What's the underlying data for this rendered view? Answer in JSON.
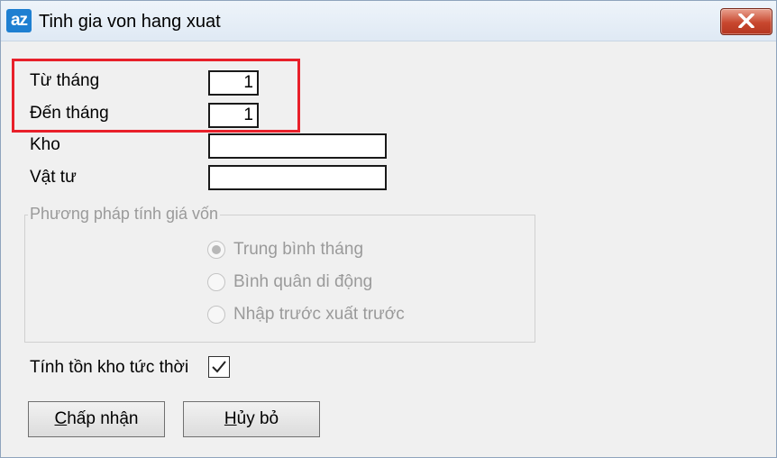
{
  "window": {
    "title": "Tinh gia von hang xuat",
    "icon_text": "az"
  },
  "form": {
    "from_month_label": "Từ tháng",
    "from_month_value": "1",
    "to_month_label": "Đến tháng",
    "to_month_value": "1",
    "warehouse_label": "Kho",
    "warehouse_value": "",
    "material_label": "Vật tư",
    "material_value": ""
  },
  "method_group": {
    "legend": "Phương pháp tính giá vốn",
    "options": [
      {
        "label": "Trung bình tháng",
        "selected": true
      },
      {
        "label": "Bình quân di động",
        "selected": false
      },
      {
        "label": "Nhập trước xuất trước",
        "selected": false
      }
    ]
  },
  "realtime_stock": {
    "label": "Tính tồn kho tức thời",
    "checked": true
  },
  "buttons": {
    "accept_first": "C",
    "accept_rest": "hấp nhận",
    "cancel_first": "H",
    "cancel_rest": "ủy bỏ"
  },
  "colors": {
    "highlight": "#e8202a",
    "title_icon": "#1e7fd1",
    "close_button": "#c8472e"
  }
}
